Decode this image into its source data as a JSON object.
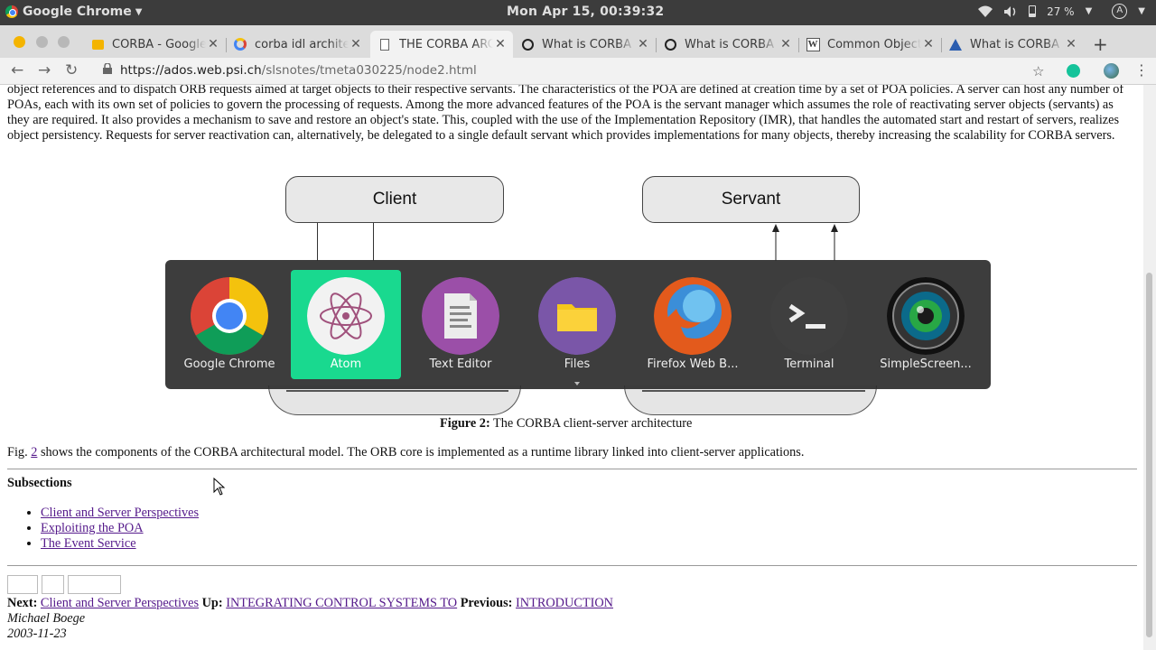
{
  "system_bar": {
    "app_name": "Google Chrome",
    "clock": "Mon Apr 15, 00:39:32",
    "battery": "27 %"
  },
  "tabs": [
    {
      "title": "CORBA - Google",
      "icon": "slides-icon",
      "active": false
    },
    {
      "title": "corba idl architecture",
      "icon": "google-icon",
      "active": false
    },
    {
      "title": "THE CORBA ARCHITECTURE",
      "icon": "page-icon",
      "active": true
    },
    {
      "title": "What is CORBA",
      "icon": "site-icon",
      "active": false
    },
    {
      "title": "What is CORBA",
      "icon": "site-icon",
      "active": false
    },
    {
      "title": "Common Object",
      "icon": "wikipedia-icon",
      "active": false
    },
    {
      "title": "What is CORBA",
      "icon": "site-icon",
      "active": false
    }
  ],
  "address_bar": {
    "host": "https://ados.web.psi.ch",
    "path": "/slsnotes/tmeta030225/node2.html"
  },
  "page": {
    "intro_text": "object references and to dispatch ORB requests aimed at target objects to their respective servants. The characteristics of the POA are defined at creation time by a set of POA policies. A server can host any number of POAs, each with its own set of policies to govern the processing of requests. Among the more advanced features of the POA is the servant manager which assumes the role of reactivating server objects (servants) as they are required. It also provides a mechanism to save and restore an object's state. This, coupled with the use of the Implementation Repository (IMR), that handles the automated start and restart of servers, realizes object persistency. Requests for server reactivation can, alternatively, be delegated to a single default servant which provides implementations for many objects, thereby increasing the scalability for CORBA servers.",
    "diagram": {
      "client_label": "Client",
      "servant_label": "Servant"
    },
    "figure_caption_prefix": "Figure 2:",
    "figure_caption_text": " The CORBA client-server architecture",
    "para_prefix": "Fig. ",
    "para_link": "2",
    "para_text": " shows the components of the CORBA architectural model. The ORB core is implemented as a runtime library linked into client-server applications.",
    "subsections_heading": "Subsections",
    "subsections": [
      "Client and Server Perspectives",
      "Exploiting the POA",
      "The Event Service"
    ],
    "nav": {
      "next_label": "Next:",
      "next_link": "Client and Server Perspectives",
      "up_label": "Up:",
      "up_link": "INTEGRATING CONTROL SYSTEMS TO",
      "prev_label": "Previous:",
      "prev_link": "INTRODUCTION"
    },
    "author": "Michael Boege",
    "date": "2003-11-23"
  },
  "app_switcher": {
    "apps": [
      {
        "label": "Google Chrome",
        "selected": false
      },
      {
        "label": "Atom",
        "selected": true
      },
      {
        "label": "Text Editor",
        "selected": false
      },
      {
        "label": "Files",
        "selected": false
      },
      {
        "label": "Firefox Web B...",
        "selected": false
      },
      {
        "label": "Terminal",
        "selected": false
      },
      {
        "label": "SimpleScreen...",
        "selected": false
      }
    ]
  },
  "colors": {
    "switcher_selected": "#19d98f",
    "link": "#551a8b",
    "topbar": "#3c3c3c"
  }
}
